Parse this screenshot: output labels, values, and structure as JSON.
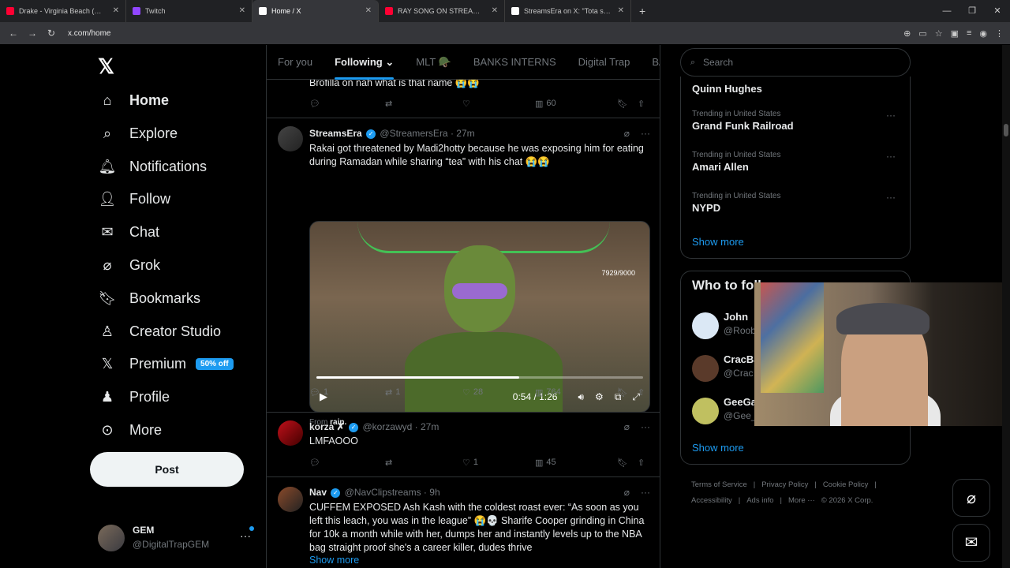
{
  "browser": {
    "tabs": [
      {
        "title": "Drake - Virginia Beach (Audio)",
        "color": "#ff0033"
      },
      {
        "title": "Twitch",
        "color": "#9146ff"
      },
      {
        "title": "Home / X",
        "color": "#ffffff"
      },
      {
        "title": "RAY SONG ON STREAM CHRIS",
        "color": "#ff0033"
      },
      {
        "title": "StreamsEra on X: \"Tota shares a",
        "color": "#ffffff"
      }
    ],
    "url": "x.com/home"
  },
  "leftnav": {
    "items": [
      {
        "label": "Home",
        "icon": "home-icon"
      },
      {
        "label": "Explore",
        "icon": "search-icon"
      },
      {
        "label": "Notifications",
        "icon": "bell-icon"
      },
      {
        "label": "Follow",
        "icon": "person-add-icon"
      },
      {
        "label": "Chat",
        "icon": "mail-icon"
      },
      {
        "label": "Grok",
        "icon": "grok-icon"
      },
      {
        "label": "Bookmarks",
        "icon": "bookmark-icon"
      },
      {
        "label": "Creator Studio",
        "icon": "creator-icon"
      },
      {
        "label": "Premium",
        "icon": "x-icon"
      },
      {
        "label": "Profile",
        "icon": "profile-icon"
      },
      {
        "label": "More",
        "icon": "more-icon"
      }
    ],
    "premium_badge": "50% off",
    "post_label": "Post",
    "account": {
      "name": "GEM",
      "handle": "@DigitalTrapGEM"
    }
  },
  "feed": {
    "tabs": [
      "For you",
      "Following",
      "MLT 🪖",
      "BANKS INTERNS",
      "Digital Trap",
      "BAU"
    ],
    "tweets": [
      {
        "text": "Brofilla on nah what is that name 😭😭",
        "views": "60"
      },
      {
        "name": "StreamsEra",
        "handle": "@StreamersEra",
        "time": "27m",
        "text": "Rakai got threatened by Madi2hotty because he was exposing him for eating during Ramadan while sharing “tea” with his chat 😭😭",
        "video_time": "0:54 / 1:26",
        "video_progress": 0.62,
        "overlay_text": "7929/9000",
        "from_label": "From",
        "from_source": "rain.",
        "replies": "1",
        "reposts": "1",
        "likes": "28",
        "views": "764"
      },
      {
        "name": "korza ✗",
        "handle": "@korzawyd",
        "time": "27m",
        "text": "LMFAOOO",
        "replies": "",
        "reposts": "",
        "likes": "1",
        "views": "45"
      },
      {
        "name": "Nav",
        "handle": "@NavClipstreams",
        "time": "9h",
        "text": "CUFFEM EXPOSED Ash Kash with the coldest roast ever: “As soon as you left this leach, you was in the league” 😭💀 Sharife Cooper grinding in China for 10k a month while with her, dumps her and instantly levels up to the NBA bag straight proof she's a career killer, dudes thrive",
        "show_more": "Show more"
      }
    ]
  },
  "right": {
    "search_placeholder": "Search",
    "trends": [
      {
        "context": "",
        "title": "Quinn Hughes"
      },
      {
        "context": "Trending in United States",
        "title": "Grand Funk Railroad"
      },
      {
        "context": "Trending in United States",
        "title": "Amari Allen"
      },
      {
        "context": "Trending in United States",
        "title": "NYPD"
      }
    ],
    "show_more": "Show more",
    "who_title": "Who to foll",
    "who": [
      {
        "name": "John",
        "handle": "@Roob"
      },
      {
        "name": "CracBa",
        "handle": "@Crac"
      },
      {
        "name": "GeeGa",
        "handle": "@Gee_"
      }
    ],
    "footer": [
      "Terms of Service",
      "|",
      "Privacy Policy",
      "|",
      "Cookie Policy",
      "|",
      "Accessibility",
      "|",
      "Ads info",
      "|",
      "More ···",
      "© 2026 X Corp."
    ]
  }
}
